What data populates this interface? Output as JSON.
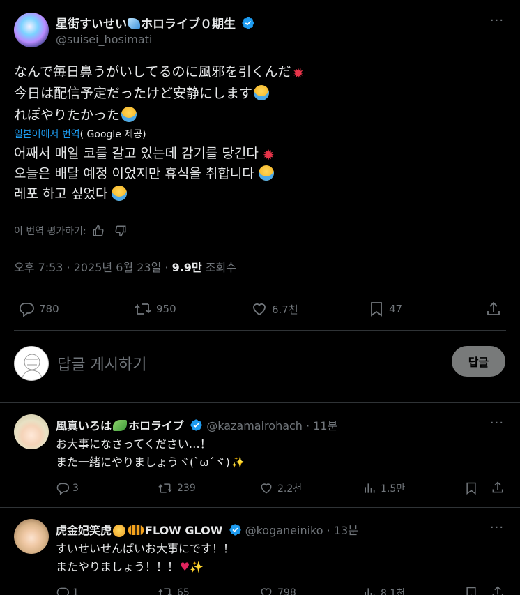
{
  "main_post": {
    "author_name": "星街すいせい",
    "author_name_suffix": "ホロライブ０期生",
    "handle": "@suisei_hosimati",
    "text_lines": [
      "なんで毎日鼻うがいしてるのに風邪を引くんだ",
      "今日は配信予定だったけど安静にします",
      "れぽやりたかった"
    ],
    "translate_link": "일본어에서 번역",
    "translate_by": "( Google 제공)",
    "translated_lines": [
      "어째서 매일 코를 갈고 있는데 감기를 당긴다",
      "오늘은 배달 예정 이었지만 휴식을 취합니다",
      "레포 하고 싶었다"
    ],
    "rate_label": "이 번역 평가하기:",
    "timestamp": "오후 7:53 · 2025년 6월 23일 · ",
    "views_count": "9.9만",
    "views_label": "조회수",
    "actions": {
      "replies": "780",
      "reposts": "950",
      "likes": "6.7천",
      "bookmarks": "47"
    }
  },
  "composer": {
    "placeholder": "답글 게시하기",
    "reply_button": "답글"
  },
  "replies": [
    {
      "name": "風真いろは",
      "name_suffix": "ホロライブ",
      "handle": "@kazamairohach",
      "time": "· 11분",
      "lines": [
        "お大事になさってください…！",
        "また一緒にやりましょうヾ(`ω´ヾ)"
      ],
      "replies": "3",
      "reposts": "239",
      "likes": "2.2천",
      "views": "1.5만"
    },
    {
      "name": "虎金妃笑虎",
      "name_suffix": "FLOW GLOW",
      "handle": "@koganeiniko",
      "time": "· 13분",
      "lines": [
        "すいせいせんぱいお大事にです！！",
        "またやりましょう！！！"
      ],
      "replies": "1",
      "reposts": "65",
      "likes": "798",
      "views": "8.1천"
    }
  ],
  "colors": {
    "background": "#000000",
    "text": "#e7e9ea",
    "muted": "#71767b",
    "link": "#1d9bf0",
    "verified": "#1d9bf0",
    "divider": "#2f3336",
    "reply_button_bg": "#787a7a"
  }
}
